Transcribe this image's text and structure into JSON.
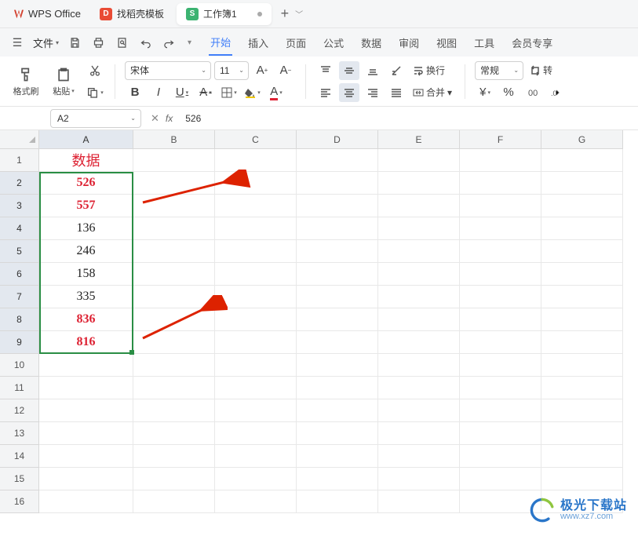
{
  "app": {
    "name": "WPS Office"
  },
  "tabs": {
    "docer": "找稻壳模板",
    "workbook": "工作簿1"
  },
  "menu": {
    "file": "文件",
    "items": [
      "开始",
      "插入",
      "页面",
      "公式",
      "数据",
      "审阅",
      "视图",
      "工具",
      "会员专享"
    ],
    "active": 0
  },
  "ribbon": {
    "format_painter": "格式刷",
    "paste": "粘贴",
    "font_name": "宋体",
    "font_size": "11",
    "wrap": "换行",
    "merge": "合并",
    "number_format": "常规",
    "rotate": "转"
  },
  "formula": {
    "cell_ref": "A2",
    "value": "526"
  },
  "columns": [
    "A",
    "B",
    "C",
    "D",
    "E",
    "F",
    "G"
  ],
  "rows": [
    "1",
    "2",
    "3",
    "4",
    "5",
    "6",
    "7",
    "8",
    "9",
    "10",
    "11",
    "12",
    "13",
    "14",
    "15",
    "16"
  ],
  "data": {
    "header": "数据",
    "values": [
      "526",
      "557",
      "136",
      "246",
      "158",
      "335",
      "836",
      "816"
    ],
    "highlight": [
      true,
      true,
      false,
      false,
      false,
      false,
      true,
      true
    ]
  },
  "watermark": {
    "main": "极光下载站",
    "sub": "www.xz7.com"
  }
}
